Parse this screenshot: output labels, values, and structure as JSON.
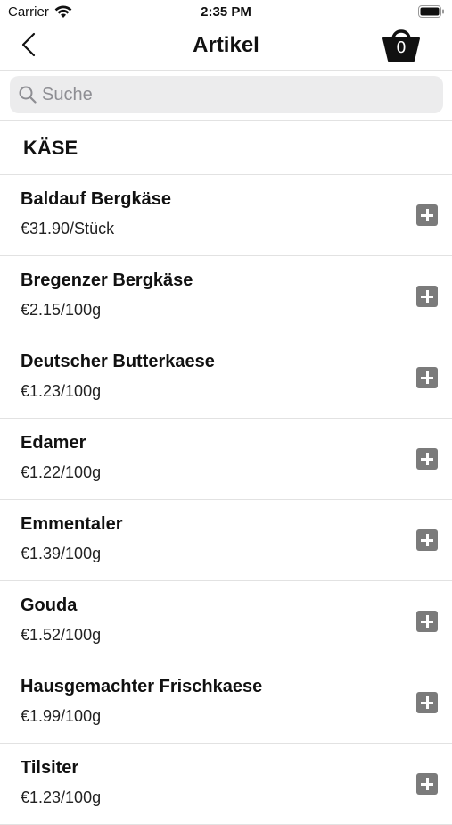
{
  "status_bar": {
    "carrier": "Carrier",
    "time": "2:35 PM",
    "icons": [
      "wifi-icon",
      "battery-icon"
    ]
  },
  "nav": {
    "title": "Artikel",
    "back_icon": "chevron-left-icon",
    "cart_icon": "shopping-basket-icon",
    "cart_count": "0"
  },
  "search": {
    "placeholder": "Suche",
    "value": ""
  },
  "section": {
    "title": "KÄSE"
  },
  "items": [
    {
      "name": "Baldauf Bergkäse",
      "price": "€31.90/Stück"
    },
    {
      "name": "Bregenzer Bergkäse",
      "price": "€2.15/100g"
    },
    {
      "name": "Deutscher Butterkaese",
      "price": "€1.23/100g"
    },
    {
      "name": "Edamer",
      "price": "€1.22/100g"
    },
    {
      "name": "Emmentaler",
      "price": "€1.39/100g"
    },
    {
      "name": "Gouda",
      "price": "€1.52/100g"
    },
    {
      "name": "Hausgemachter Frischkaese",
      "price": "€1.99/100g"
    },
    {
      "name": "Tilsiter",
      "price": "€1.23/100g"
    }
  ],
  "colors": {
    "add_button": "#7b7b7b",
    "search_bg": "#ececed",
    "divider": "#e2e2e2"
  }
}
